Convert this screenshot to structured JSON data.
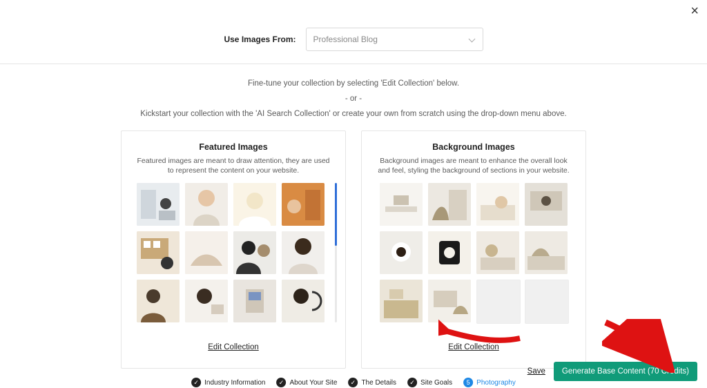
{
  "close_label": "×",
  "top": {
    "label": "Use Images From:",
    "select_value": "Professional Blog"
  },
  "intro": {
    "line1": "Fine-tune your collection by selecting 'Edit Collection' below.",
    "or": "- or -",
    "line2": "Kickstart your collection with the 'AI Search Collection' or create your own from scratch using the drop-down menu above."
  },
  "panels": {
    "featured": {
      "title": "Featured Images",
      "desc": "Featured images are meant to draw attention, they are used to represent the content on your website.",
      "edit": "Edit Collection"
    },
    "background": {
      "title": "Background Images",
      "desc": "Background images are meant to enhance the overall look and feel, styling the background of sections in your website.",
      "edit": "Edit Collection"
    }
  },
  "steps": {
    "s1": "Industry Information",
    "s2": "About Your Site",
    "s3": "The Details",
    "s4": "Site Goals",
    "s5": "Photography",
    "s5_num": "5"
  },
  "actions": {
    "save": "Save",
    "generate": "Generate Base Content (70 Credits)"
  }
}
